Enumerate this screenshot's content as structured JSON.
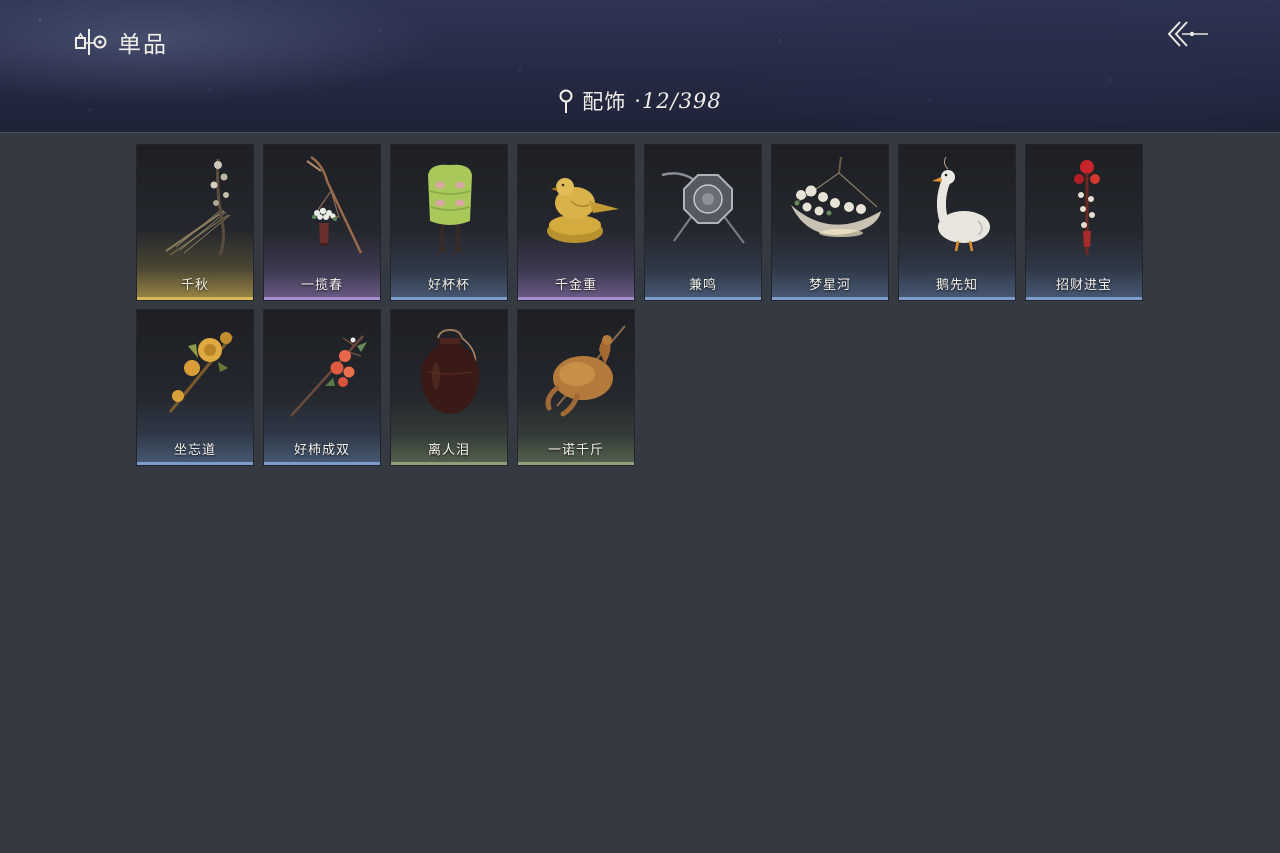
{
  "header": {
    "title": "单品",
    "title_icon": "collection-icon",
    "back_icon": "back-arrow-icon"
  },
  "category": {
    "icon": "pin-icon",
    "label": "配饰",
    "count": "·12/398"
  },
  "items": [
    {
      "name": "千秋",
      "rarity": "gold",
      "icon": "zither-branch-icon"
    },
    {
      "name": "一揽春",
      "rarity": "purple",
      "icon": "flower-basket-staff-icon"
    },
    {
      "name": "好杯杯",
      "rarity": "blue",
      "icon": "green-cup-creature-icon"
    },
    {
      "name": "千金重",
      "rarity": "purple",
      "icon": "golden-bird-icon"
    },
    {
      "name": "兼鸣",
      "rarity": "blue",
      "icon": "octagonal-shield-icon"
    },
    {
      "name": "梦星河",
      "rarity": "blue",
      "icon": "flower-boat-icon"
    },
    {
      "name": "鹅先知",
      "rarity": "blue",
      "icon": "goose-icon"
    },
    {
      "name": "招财进宝",
      "rarity": "blue",
      "icon": "red-tassel-charm-icon"
    },
    {
      "name": "坐忘道",
      "rarity": "blue",
      "icon": "golden-flower-hairpin-icon"
    },
    {
      "name": "好柿成双",
      "rarity": "blue",
      "icon": "persimmon-branch-icon"
    },
    {
      "name": "离人泪",
      "rarity": "green",
      "icon": "wine-jar-icon"
    },
    {
      "name": "一诺千斤",
      "rarity": "green",
      "icon": "roast-chicken-icon"
    }
  ],
  "colors": {
    "background": "#353942",
    "gold": "#d9b95a",
    "purple": "#a78ccf",
    "blue": "#7d9ccb",
    "green": "#8fa07a"
  }
}
